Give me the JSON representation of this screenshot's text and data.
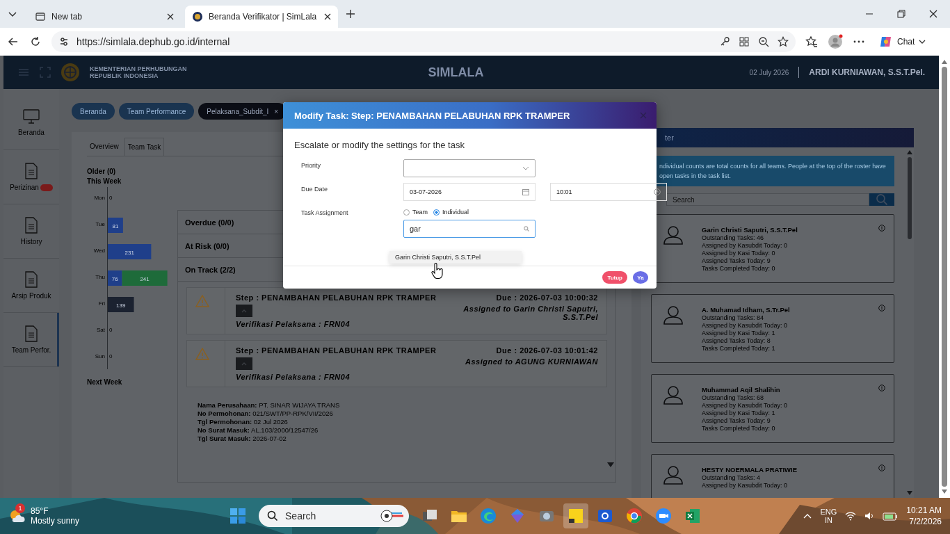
{
  "browser": {
    "tabs": [
      {
        "title": "New tab",
        "selected": false
      },
      {
        "title": "Beranda Verifikator | SimLala",
        "selected": true
      }
    ],
    "url": "https://simlala.dephub.go.id/internal",
    "chat": "Chat"
  },
  "header": {
    "org_line1": "KEMENTERIAN PERHUBUNGAN",
    "org_line2": "REPUBLIK INDONESIA",
    "title": "SIMLALA",
    "date": "02 July 2026",
    "user": "ARDI KURNIAWAN, S.S.T.Pel."
  },
  "sidebar": {
    "items": [
      {
        "label": "Beranda",
        "selected": false,
        "badge": false
      },
      {
        "label": "Perizinan",
        "selected": false,
        "badge": true
      },
      {
        "label": "History",
        "selected": false,
        "badge": false
      },
      {
        "label": "Arsip Produk",
        "selected": false,
        "badge": false
      },
      {
        "label": "Team Perfor.",
        "selected": true,
        "badge": false
      }
    ]
  },
  "breadcrumbs": [
    {
      "label": "Beranda",
      "selected": false,
      "closable": false
    },
    {
      "label": "Team Performance",
      "selected": false,
      "closable": false
    },
    {
      "label": "Pelaksana_Subdit_I",
      "selected": true,
      "closable": true
    }
  ],
  "close_mark": "×",
  "view_tabs": [
    {
      "label": "Overview",
      "selected": false
    },
    {
      "label": "Team Task",
      "selected": true
    }
  ],
  "week": {
    "older": "Older (0)",
    "this_week": "This Week",
    "next_week": "Next Week",
    "chart_data": {
      "type": "bar",
      "orientation": "horizontal",
      "stacked": true,
      "categories": [
        "Mon",
        "Tue",
        "Wed",
        "Thu",
        "Fri",
        "Sat",
        "Sun"
      ],
      "series": [
        {
          "color": "#1f3f8a",
          "values": [
            0,
            81,
            231,
            76,
            0,
            0,
            0
          ],
          "value_labels": [
            "0",
            "81",
            "231",
            "76",
            null,
            "0",
            "0"
          ]
        },
        {
          "color": "#1e6b3a",
          "values": [
            0,
            0,
            0,
            241,
            0,
            0,
            0
          ],
          "value_labels": [
            null,
            null,
            null,
            "241",
            null,
            null,
            null
          ]
        },
        {
          "color": "#1b2230",
          "values": [
            0,
            0,
            0,
            0,
            139,
            0,
            0
          ],
          "value_labels": [
            null,
            null,
            null,
            null,
            "139",
            null,
            null
          ]
        }
      ]
    }
  },
  "groups": [
    {
      "label": "Overdue (0/0)"
    },
    {
      "label": "At Risk (0/0)"
    },
    {
      "label": "On Track (2/2)"
    }
  ],
  "tasks": [
    {
      "step": "Step : PENAMBAHAN PELABUHAN RPK TRAMPER",
      "sub": "Verifikasi Pelaksana : FRN04",
      "due": "Due : 2026-07-03 10:00:32",
      "assigned": "Assigned to Garin Christi Saputri, S.S.T.Pel"
    },
    {
      "step": "Step : PENAMBAHAN PELABUHAN RPK TRAMPER",
      "sub": "Verifikasi Pelaksana : FRN04",
      "due": "Due : 2026-07-03 10:01:42",
      "assigned": "Assigned to AGUNG KURNIAWAN"
    }
  ],
  "details": [
    {
      "label": "Nama Perusahaan:",
      "value": "PT. SINAR WIJAYA TRANS"
    },
    {
      "label": "No Permohonan:",
      "value": "021/SWT/PP-RPK/VII/2026"
    },
    {
      "label": "Tgl Permohonan:",
      "value": "02 Jul 2026"
    },
    {
      "label": "No Surat Masuk:",
      "value": "AL.103/2000/12547/26"
    },
    {
      "label": "Tgl Surat Masuk:",
      "value": "2026-07-02"
    }
  ],
  "roster": {
    "title": "ter",
    "info": "ndividual counts are total counts for all teams. People at the top of the roster have open tasks in the task list.",
    "search_placeholder": "Search",
    "people": [
      {
        "name": "Garin Christi Saputri, S.S.T.Pel",
        "stats": [
          "Outstanding Tasks: 46",
          "Assigned by Kasubdit Today: 0",
          "Assigned by Kasi Today: 0",
          "Assigned Tasks Today: 9",
          "Tasks Completed Today: 0"
        ]
      },
      {
        "name": "A. Muhamad Idham, S.Tr.Pel",
        "stats": [
          "Outstanding Tasks: 84",
          "Assigned by Kasubdit Today: 0",
          "Assigned by Kasi Today: 1",
          "Assigned Tasks Today: 8",
          "Tasks Completed Today: 1"
        ]
      },
      {
        "name": "Muhammad Aqil Shalihin",
        "stats": [
          "Outstanding Tasks: 68",
          "Assigned by Kasubdit Today: 0",
          "Assigned by Kasi Today: 1",
          "Assigned Tasks Today: 9",
          "Tasks Completed Today: 0"
        ]
      },
      {
        "name": "HESTY NOERMALA PRATIWIE",
        "stats": [
          "Outstanding Tasks: 4",
          "Assigned by Kasubdit Today: 0"
        ]
      }
    ]
  },
  "modal": {
    "title": "Modify Task: Step: PENAMBAHAN PELABUHAN RPK TRAMPER",
    "subtitle": "Escalate or modify the settings for the task",
    "priority_label": "Priority",
    "due_label": "Due Date",
    "due_date": "03-07-2026",
    "due_time": "10:01",
    "assign_label": "Task Assignment",
    "assign_options": [
      {
        "label": "Team",
        "selected": false
      },
      {
        "label": "Individual",
        "selected": true
      }
    ],
    "search_value": "gar",
    "suggestions": [
      "Garin Christi Saputri, S.S.T.Pel"
    ],
    "buttons": [
      {
        "label": "Tutup",
        "kind": "cancel"
      },
      {
        "label": "Ya",
        "kind": "confirm"
      }
    ]
  },
  "taskbar": {
    "temperature": "85°F",
    "weather": "Mostly sunny",
    "notification_count": "1",
    "search_placeholder": "Search",
    "lang": "ENG",
    "region": "IN",
    "time": "10:21 AM",
    "date": "7/2/2026"
  }
}
